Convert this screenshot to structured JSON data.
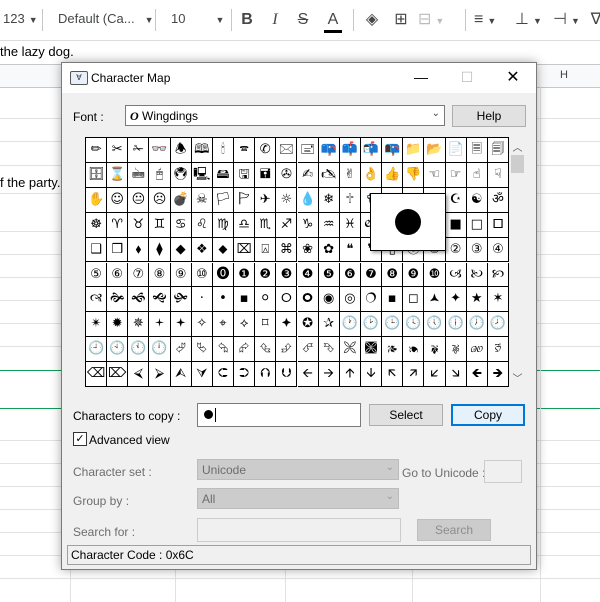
{
  "sheet": {
    "toolbar": {
      "format_label": "123",
      "font_label": "Default (Ca...",
      "font_size": "10"
    },
    "rows": {
      "row1_text": "the lazy dog.",
      "row2_text": "f the party."
    },
    "column_h": "H"
  },
  "dialog": {
    "title": "Character Map",
    "font_label": "Font :",
    "font_value": "Wingdings",
    "help_label": "Help",
    "chars_to_copy_label": "Characters to copy :",
    "select_label": "Select",
    "copy_label": "Copy",
    "advanced_view_label": "Advanced view",
    "advanced_view_checked": true,
    "char_set_label": "Character set :",
    "char_set_value": "Unicode",
    "go_to_unicode_label": "Go to Unicode :",
    "group_by_label": "Group by :",
    "group_by_value": "All",
    "search_for_label": "Search for :",
    "search_label": "Search",
    "status": "Character Code : 0x6C"
  },
  "grid": {
    "columns": 20,
    "rows": [
      [
        "✏",
        "✂",
        "✁",
        "👓",
        "🕭",
        "🕮",
        "🕯",
        "🕿",
        "✆",
        "🖂",
        "🖃",
        "📪",
        "📫",
        "📬",
        "📭",
        "📁",
        "📂",
        "📄",
        "🗏",
        "🗐"
      ],
      [
        "🗄",
        "⌛",
        "🖮",
        "🖰",
        "🖲",
        "🖳",
        "🖴",
        "🖫",
        "🖬",
        "✇",
        "✍",
        "🖎",
        "✌",
        "👌",
        "👍",
        "👎",
        "☜",
        "☞",
        "☝",
        "☟"
      ],
      [
        "✋",
        "☺",
        "😐",
        "☹",
        "💣",
        "☠",
        "🏳",
        "🏱",
        "✈",
        "☼",
        "💧",
        "❄",
        "🕆",
        "✞",
        "🕈",
        "✠",
        "✡",
        "☪",
        "☯",
        "ॐ"
      ],
      [
        "☸",
        "♈",
        "♉",
        "♊",
        "♋",
        "♌",
        "♍",
        "♎",
        "♏",
        "♐",
        "♑",
        "♒",
        "♓",
        "🙰",
        "🙵",
        "●",
        "🔾",
        "■",
        "□",
        "🞐"
      ],
      [
        "❑",
        "❒",
        "⬧",
        "⧫",
        "◆",
        "❖",
        "⬥",
        "⌧",
        "⍓",
        "⌘",
        "❀",
        "✿",
        "❝",
        "❞",
        "▯",
        "⓪",
        "①",
        "②",
        "③",
        "④"
      ],
      [
        "⑤",
        "⑥",
        "⑦",
        "⑧",
        "⑨",
        "⑩",
        "⓿",
        "❶",
        "❷",
        "❸",
        "❹",
        "❺",
        "❻",
        "❼",
        "❽",
        "❾",
        "❿",
        "🙢",
        "🙠",
        "🙡"
      ],
      [
        "🙣",
        "🙞",
        "🙜",
        "🙝",
        "🙟",
        "·",
        "•",
        "▪",
        "⚪",
        "🞆",
        "🞈",
        "◉",
        "◎",
        "🔿",
        "▪",
        "◻",
        "🟂",
        "✦",
        "★",
        "✶"
      ],
      [
        "✴",
        "✹",
        "✵",
        "🟄",
        "🟅",
        "✧",
        "⌖",
        "⟡",
        "⌑",
        "🟆",
        "✪",
        "✰",
        "🕐",
        "🕑",
        "🕒",
        "🕓",
        "🕔",
        "🕕",
        "🕖",
        "🕗"
      ],
      [
        "🕘",
        "🕙",
        "🕚",
        "🕛",
        "⮰",
        "⮱",
        "⮲",
        "⮳",
        "⮴",
        "⮵",
        "⮶",
        "⮷",
        "🙪",
        "🙫",
        "🙕",
        "🙔",
        "🙗",
        "🙖",
        "🙐",
        "🙑"
      ],
      [
        "⌫",
        "⌦",
        "⮘",
        "⮚",
        "⮙",
        "⮛",
        "⮈",
        "⮊",
        "⮉",
        "⮋",
        "🡨",
        "🡪",
        "🡩",
        "🡫",
        "🡬",
        "🡭",
        "🡯",
        "🡮",
        "🡸",
        "🡺"
      ]
    ]
  }
}
